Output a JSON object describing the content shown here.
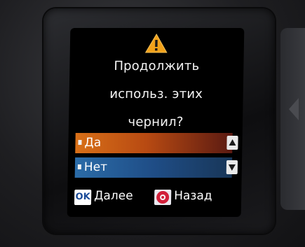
{
  "dialog": {
    "icon": "warning-triangle-icon",
    "lines": [
      "Продолжить",
      "использ. этих",
      "чернил?"
    ]
  },
  "options": [
    {
      "label": "Да",
      "selected": true
    },
    {
      "label": "Нет",
      "selected": false
    }
  ],
  "footer": {
    "ok_key": "OK",
    "ok_label": "Далее",
    "back_icon": "stop-icon",
    "back_label": "Назад"
  },
  "colors": {
    "selected_row": "#d87018",
    "normal_row": "#2b6ca8",
    "warning": "#f2a21a"
  }
}
